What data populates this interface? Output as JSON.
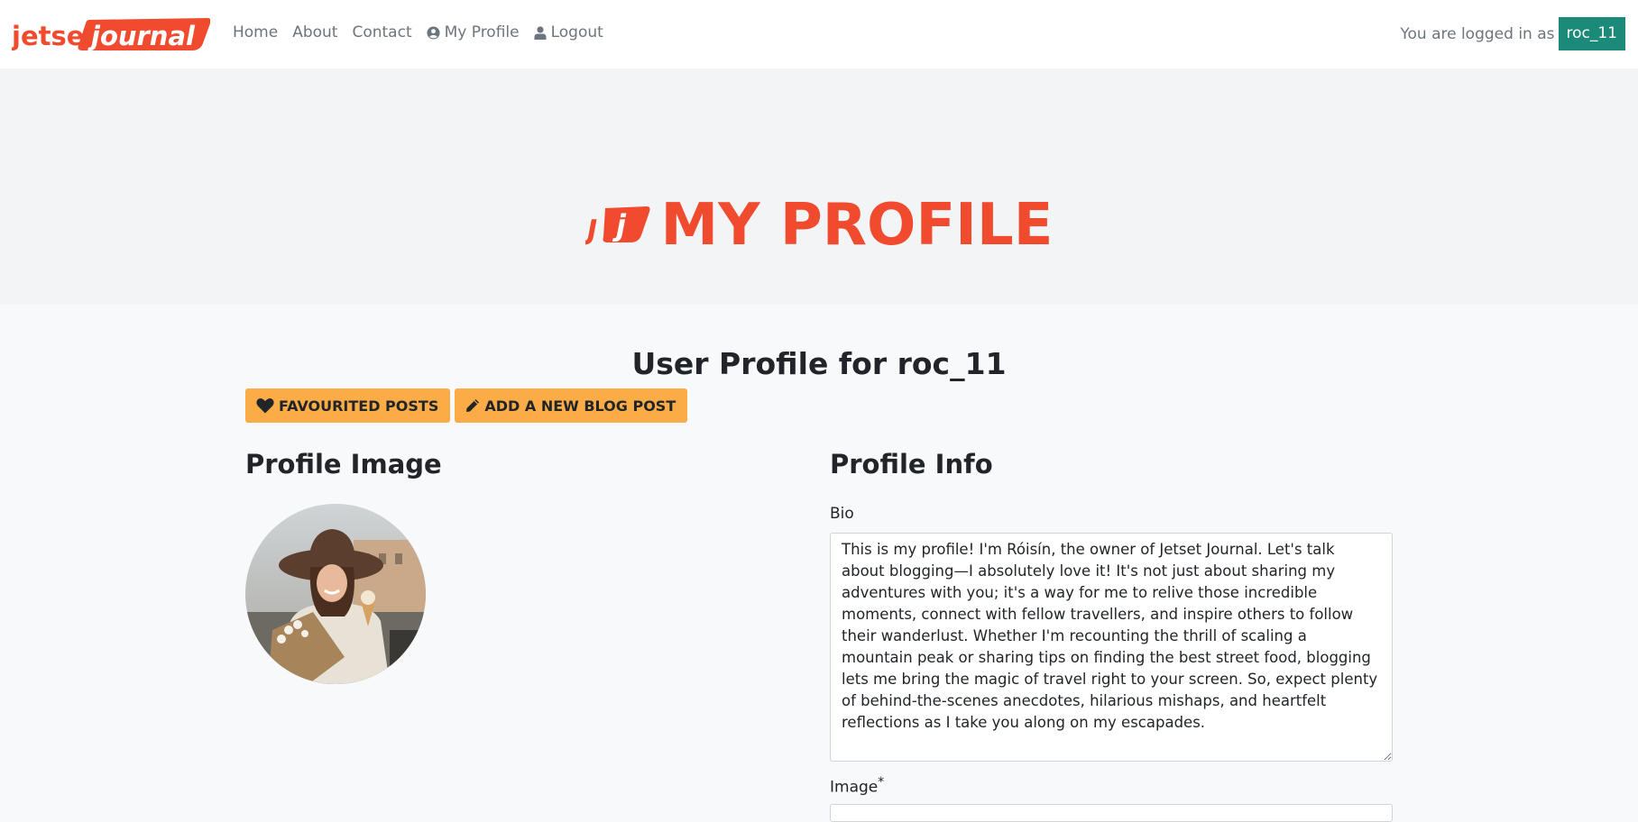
{
  "brand": {
    "logo_text_1": "jetset",
    "logo_text_2": "journal",
    "accent_color": "#f04a2f"
  },
  "nav": {
    "items": [
      {
        "label": "Home"
      },
      {
        "label": "About"
      },
      {
        "label": "Contact"
      },
      {
        "label": "My Profile",
        "icon": "user-circle-icon"
      },
      {
        "label": "Logout",
        "icon": "user-icon"
      }
    ],
    "logged_in_prefix": "You are logged in as",
    "username": "roc_11",
    "badge_color": "#1b8a78"
  },
  "hero": {
    "title": "MY PROFILE"
  },
  "profile": {
    "heading": "User Profile for roc_11",
    "favourited_button": "FAVOURITED POSTS",
    "add_post_button": "ADD A NEW BLOG POST",
    "button_color": "#fbac46",
    "image_section_title": "Profile Image",
    "info_section_title": "Profile Info",
    "bio_label": "Bio",
    "bio_text": "This is my profile! I'm Róisín, the owner of Jetset Journal. Let's talk about blogging—I absolutely love it! It's not just about sharing my adventures with you; it's a way for me to relive those incredible moments, connect with fellow travellers, and inspire others to follow their wanderlust. Whether I'm recounting the thrill of scaling a mountain peak or sharing tips on finding the best street food, blogging lets me bring the magic of travel right to your screen. So, expect plenty of behind-the-scenes anecdotes, hilarious mishaps, and heartfelt reflections as I take you along on my escapades.",
    "image_label": "Image",
    "required_marker": "*"
  }
}
